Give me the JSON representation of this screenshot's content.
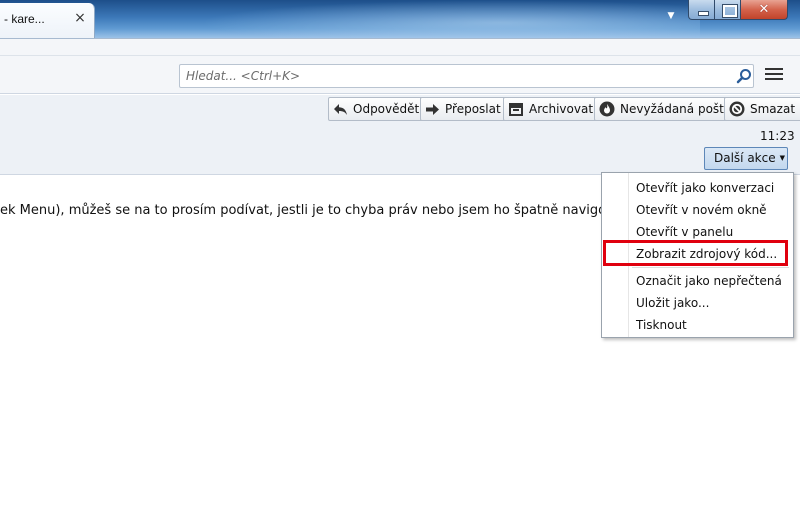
{
  "window": {
    "tab_title": "- kare...",
    "tab_close": "×",
    "tab_list": "▼",
    "close_glyph": "✕"
  },
  "search": {
    "placeholder": "Hledat... <Ctrl+K>"
  },
  "toolbar_buttons": {
    "reply": "Odpovědět",
    "forward": "Přeposlat",
    "archive": "Archivovat",
    "junk": "Nevyžádaná pošta",
    "delete": "Smazat"
  },
  "message": {
    "time": "11:23",
    "more_actions": "Další akce",
    "body_snippet": "ek Menu), můžeš se na to prosím podívat, jestli je to chyba práv nebo jsem ho špatně navigovala?"
  },
  "menu": {
    "items": [
      "Otevřít jako konverzaci",
      "Otevřít v novém okně",
      "Otevřít v panelu",
      "Zobrazit zdrojový kód...",
      "Označit jako nepřečtená",
      "Uložit jako...",
      "Tisknout"
    ],
    "highlighted_index": 3
  },
  "colors": {
    "highlight": "#e0000e",
    "accent": "#5d87b8"
  }
}
